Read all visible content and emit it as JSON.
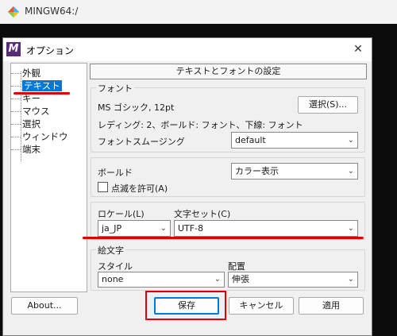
{
  "terminal": {
    "title": "MINGW64:/"
  },
  "dialog": {
    "title": "オプション",
    "icon_letter": "M",
    "close_glyph": "✕",
    "tree": [
      {
        "label": "外観"
      },
      {
        "label": "テキスト",
        "selected": true
      },
      {
        "label": "キー"
      },
      {
        "label": "マウス"
      },
      {
        "label": "選択"
      },
      {
        "label": "ウィンドウ"
      },
      {
        "label": "端末"
      }
    ],
    "page_header": "テキストとフォントの設定",
    "font_group": {
      "legend": "フォント",
      "font_info": "MS ゴシック, 12pt",
      "select_button": "選択(S)...",
      "details": "レディング: 2、ボールド: フォント、下線: フォント",
      "smoothing_label": "フォントスムージング",
      "smoothing_value": "default"
    },
    "bold_group": {
      "bold_label": "ボールド",
      "bold_value": "カラー表示",
      "blink_label": "点滅を許可(A)",
      "blink_checked": false
    },
    "locale_group": {
      "locale_label": "ロケール(L)",
      "locale_value": "ja_JP",
      "charset_label": "文字セット(C)",
      "charset_value": "UTF-8"
    },
    "emoji_group": {
      "legend": "絵文字",
      "style_label": "スタイル",
      "style_value": "none",
      "placement_label": "配置",
      "placement_value": "伸張"
    },
    "buttons": {
      "about": "About...",
      "save": "保存",
      "cancel": "キャンセル",
      "apply": "適用"
    }
  },
  "colors": {
    "annotation": "#e00000",
    "selection": "#0078d7"
  }
}
